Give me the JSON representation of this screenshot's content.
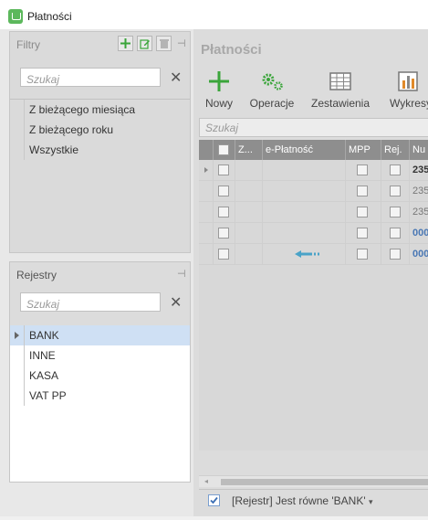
{
  "window": {
    "title": "Płatności"
  },
  "filters_panel": {
    "title": "Filtry",
    "search_placeholder": "Szukaj",
    "items": [
      {
        "label": "Z bieżącego miesiąca"
      },
      {
        "label": "Z bieżącego roku"
      },
      {
        "label": "Wszystkie"
      }
    ]
  },
  "registers_panel": {
    "title": "Rejestry",
    "search_placeholder": "Szukaj",
    "items": [
      {
        "label": "BANK",
        "selected": true
      },
      {
        "label": "INNE"
      },
      {
        "label": "KASA"
      },
      {
        "label": "VAT PP"
      }
    ]
  },
  "main": {
    "title": "Płatności",
    "toolbar": [
      {
        "label": "Nowy",
        "icon": "plus-icon"
      },
      {
        "label": "Operacje",
        "icon": "gears-icon"
      },
      {
        "label": "Zestawienia",
        "icon": "table-icon"
      },
      {
        "label": "Wykresy",
        "icon": "chart-icon"
      }
    ],
    "grid_search_placeholder": "Szukaj",
    "columns": [
      "Z...",
      "e-Płatność",
      "MPP",
      "Rej.",
      "Nu"
    ],
    "rows": [
      {
        "number": "235",
        "color": "#333333"
      },
      {
        "number": "235",
        "color": "#777777"
      },
      {
        "number": "235",
        "color": "#777777"
      },
      {
        "number": "000",
        "color": "#4a78b5"
      },
      {
        "number": "000",
        "color": "#4a78b5"
      }
    ],
    "filter_text": "[Rejestr] Jest równe 'BANK'"
  },
  "colors": {
    "accent_green": "#5cb85c",
    "selection": "#cfe0f4",
    "link_blue": "#4a78b5"
  }
}
